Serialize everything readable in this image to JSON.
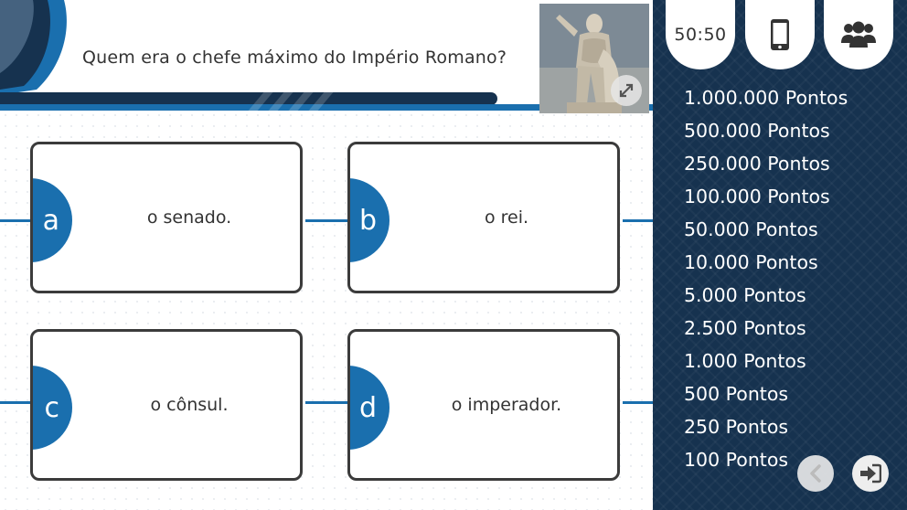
{
  "question": {
    "text": "Quem era o chefe máximo do Império Romano?",
    "image_icon": "statue-augustus-image"
  },
  "answers": [
    {
      "letter": "a",
      "text": "o senado."
    },
    {
      "letter": "b",
      "text": "o rei."
    },
    {
      "letter": "c",
      "text": "o cônsul."
    },
    {
      "letter": "d",
      "text": "o imperador."
    }
  ],
  "lifelines": {
    "fifty_fifty": "50:50",
    "phone_icon": "phone-icon",
    "audience_icon": "audience-icon"
  },
  "prizes": [
    "1.000.000 Pontos",
    "500.000 Pontos",
    "250.000 Pontos",
    "100.000 Pontos",
    "50.000 Pontos",
    "10.000 Pontos",
    "5.000 Pontos",
    "2.500 Pontos",
    "1.000 Pontos",
    "500 Pontos",
    "250 Pontos",
    "100 Pontos"
  ],
  "current_prize": "250 Pontos",
  "colors": {
    "navy": "#16324f",
    "accent_blue": "#1a6fae",
    "border": "#3b3b3b"
  }
}
